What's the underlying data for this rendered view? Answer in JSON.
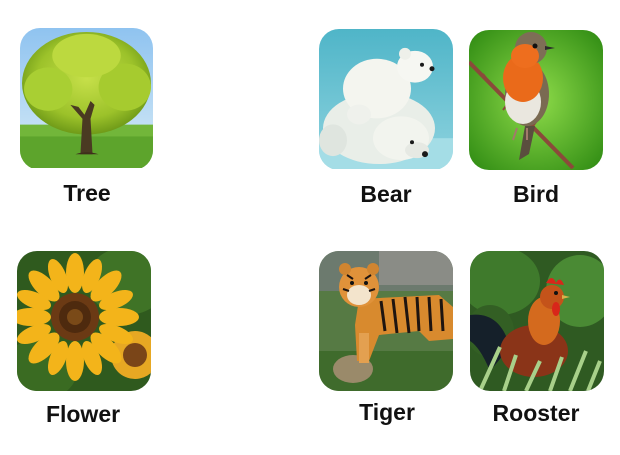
{
  "cards": [
    {
      "label": "Tree",
      "image": "tree-photo"
    },
    {
      "label": "Bear",
      "image": "polar-bear-photo"
    },
    {
      "label": "Bird",
      "image": "robin-photo"
    },
    {
      "label": "Flower",
      "image": "sunflower-photo"
    },
    {
      "label": "Tiger",
      "image": "tiger-photo"
    },
    {
      "label": "Rooster",
      "image": "rooster-photo"
    }
  ]
}
